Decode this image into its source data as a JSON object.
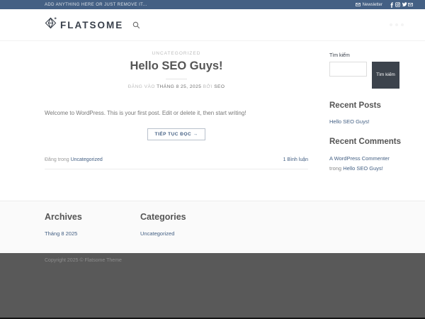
{
  "topbar": {
    "left_text": "ADD ANYTHING HERE OR JUST REMOVE IT...",
    "newsletter_label": "Newsletter",
    "social_icons": [
      "envelope-icon",
      "facebook-icon",
      "instagram-icon",
      "twitter-icon",
      "email-icon"
    ]
  },
  "header": {
    "brand": "FLATSOME",
    "icons": [
      "flatsome-gem-logo",
      "search-icon"
    ]
  },
  "post": {
    "category_label": "UNCATEGORIZED",
    "title": "Hello SEO Guys!",
    "meta": {
      "posted_on": "ĐĂNG VÀO",
      "date": "THÁNG 8 25, 2025",
      "by": "BỞI",
      "author": "SEO"
    },
    "excerpt": "Welcome to WordPress. This is your first post. Edit or delete it, then start writing!",
    "read_more_label": "TIẾP TỤC ĐỌC →",
    "footer_meta": {
      "posted_in": "Đăng trong",
      "category": "Uncategorized",
      "comments": "1 Bình luận"
    }
  },
  "sidebar": {
    "search": {
      "label": "Tìm kiếm",
      "input_value": "",
      "button_label": "Tìm kiếm"
    },
    "recent_posts": {
      "title": "Recent Posts",
      "items": [
        "Hello SEO Guys!"
      ]
    },
    "recent_comments": {
      "title": "Recent Comments",
      "items": [
        {
          "author": "A WordPress Commenter",
          "connector": "trong",
          "post": "Hello SEO Guys!"
        }
      ]
    }
  },
  "footer": {
    "archives": {
      "title": "Archives",
      "items": [
        "Tháng 8 2025"
      ]
    },
    "categories": {
      "title": "Categories",
      "items": [
        "Uncategorized"
      ]
    },
    "copyright": "Copyright 2025 © Flatsome Theme"
  },
  "colors": {
    "primary": "#446084",
    "topbar_bg": "#446084",
    "heading": "#555555",
    "link": "#446084",
    "muted": "#bcbcbc",
    "search_button_bg": "#3c434c",
    "footer_widgets_bg": "#fafafa",
    "dark_footer_bg": "#595959"
  }
}
